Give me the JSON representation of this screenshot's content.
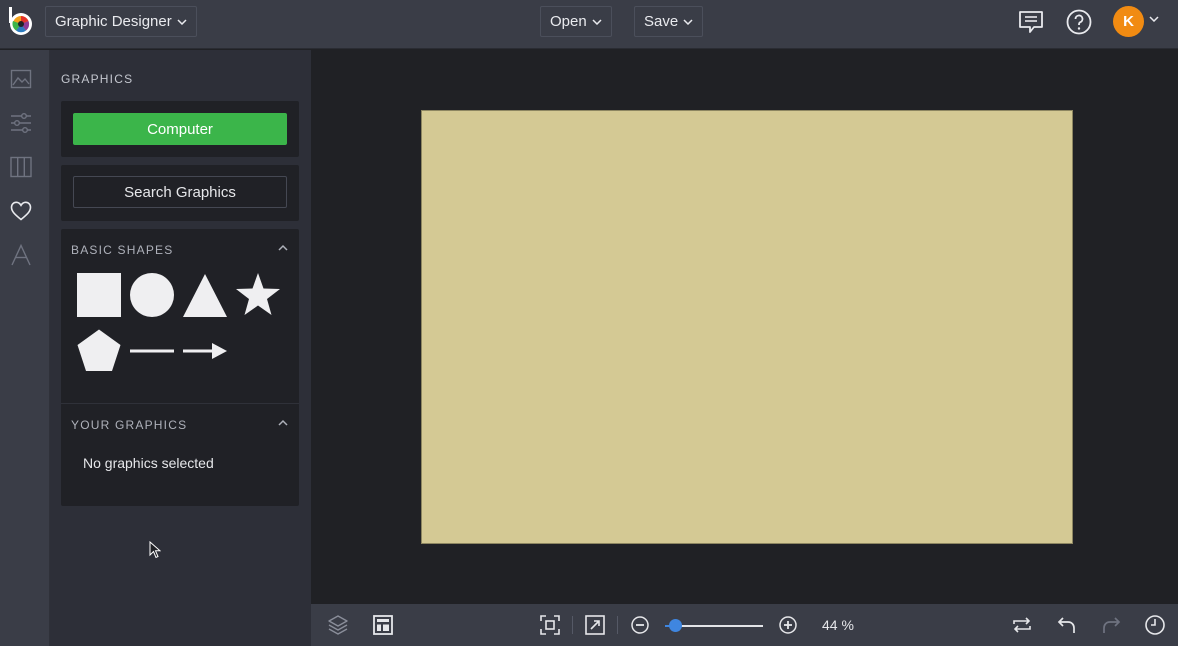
{
  "header": {
    "app_switcher": "Graphic Designer",
    "open_label": "Open",
    "save_label": "Save",
    "avatar_initial": "K"
  },
  "panel": {
    "title": "GRAPHICS",
    "computer_button": "Computer",
    "search_button": "Search Graphics",
    "basic_shapes": {
      "title": "BASIC SHAPES",
      "shapes": [
        "square",
        "circle",
        "triangle",
        "star",
        "pentagon",
        "line",
        "arrow"
      ]
    },
    "your_graphics": {
      "title": "YOUR GRAPHICS",
      "empty_text": "No graphics selected"
    }
  },
  "canvas": {
    "background_color": "#d4c994"
  },
  "footer": {
    "zoom_value": 0.44,
    "zoom_label": "44 %"
  },
  "colors": {
    "accent_green": "#3bb54a",
    "avatar_orange": "#f18b12",
    "slider_blue": "#3f86e0"
  }
}
